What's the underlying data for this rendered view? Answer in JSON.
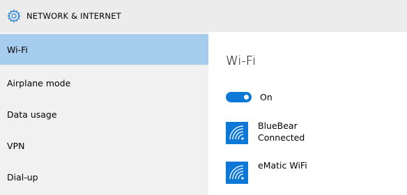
{
  "header": {
    "icon": "gear-icon",
    "title": "NETWORK & INTERNET",
    "accent_color": "#0e78d6"
  },
  "sidebar": {
    "items": [
      {
        "label": "Wi-Fi",
        "selected": true
      },
      {
        "label": "Airplane mode",
        "selected": false
      },
      {
        "label": "Data usage",
        "selected": false
      },
      {
        "label": "VPN",
        "selected": false
      },
      {
        "label": "Dial-up",
        "selected": false
      }
    ],
    "selected_color": "#a7cdee"
  },
  "main": {
    "title": "Wi-Fi",
    "wifi_toggle": {
      "state": "on",
      "label": "On"
    },
    "networks": [
      {
        "name": "BlueBear",
        "status": "Connected",
        "icon": "wifi-signal-icon"
      },
      {
        "name": "eMatic WiFi",
        "status": "",
        "icon": "wifi-signal-icon"
      }
    ]
  }
}
